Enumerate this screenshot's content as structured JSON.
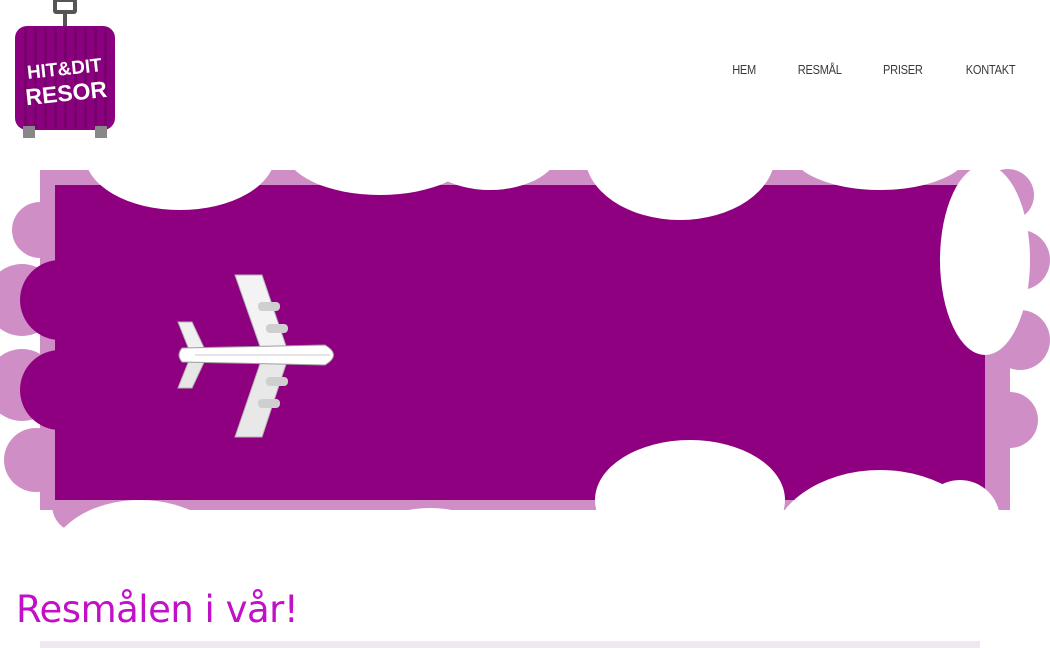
{
  "brand": {
    "line1": "HIT&DIT",
    "line2": "RESOR",
    "color": "#8b007f"
  },
  "nav": {
    "items": [
      "HEM",
      "RESMÅL",
      "PRISER",
      "KONTAKT"
    ]
  },
  "hero": {
    "image": "airplane-over-clouds",
    "background_color": "#8e007f",
    "cloud_shadow_color": "#cf8fc6"
  },
  "main": {
    "headline": "Resmålen i vår!",
    "headline_color": "#c20fc8"
  }
}
